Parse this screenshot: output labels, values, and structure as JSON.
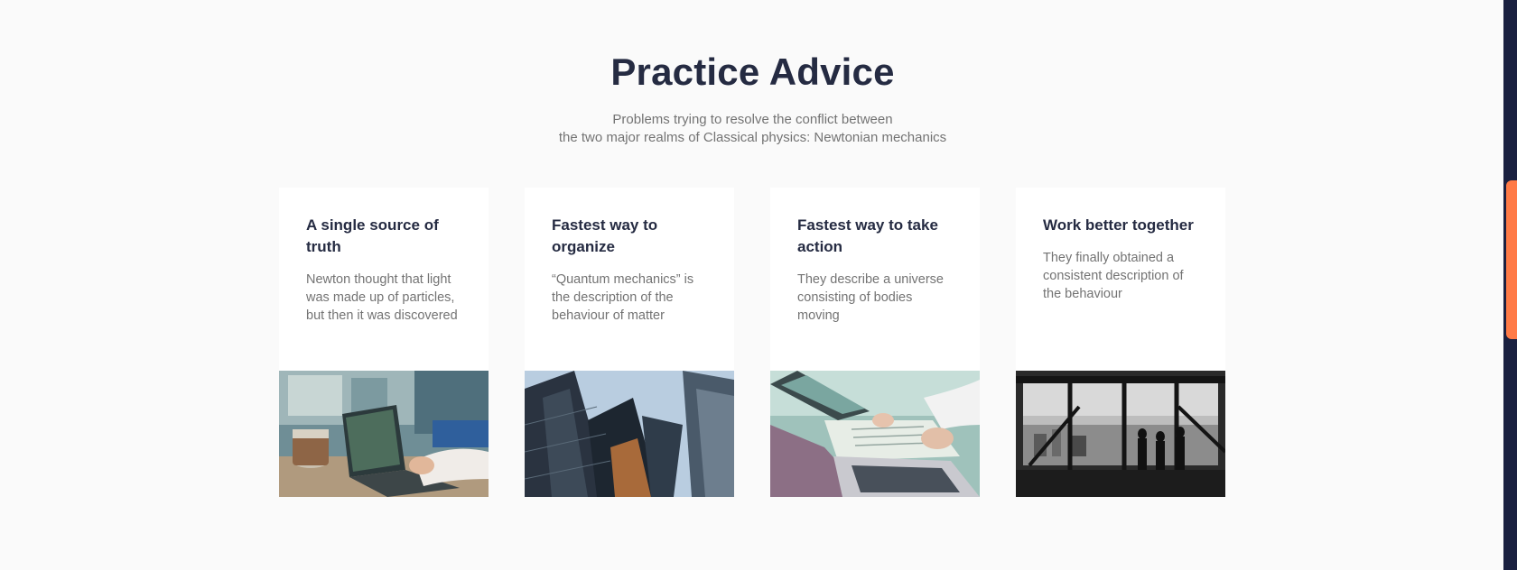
{
  "section": {
    "title": "Practice Advice",
    "subtitle_line1": "Problems trying to resolve the conflict between",
    "subtitle_line2": "the two major realms of Classical physics: Newtonian mechanics"
  },
  "cards": [
    {
      "title": "A single source of truth",
      "text": "Newton thought that light was made up of particles, but then it was discovered",
      "image": "laptop-coffee-photo"
    },
    {
      "title": "Fastest way to organize",
      "text": "“Quantum mechanics” is the description of the behaviour of matter",
      "image": "skyscrapers-photo"
    },
    {
      "title": "Fastest way to take action",
      "text": "They describe a universe consisting of bodies moving",
      "image": "notes-laptop-photo"
    },
    {
      "title": "Work better together",
      "text": "They finally obtained a consistent description of the behaviour",
      "image": "office-window-photo"
    }
  ],
  "colors": {
    "heading": "#252b42",
    "body_text": "#737373",
    "background": "#fafafa",
    "scrollbar_track": "#1a2040",
    "scrollbar_thumb": "#ff7b47"
  }
}
